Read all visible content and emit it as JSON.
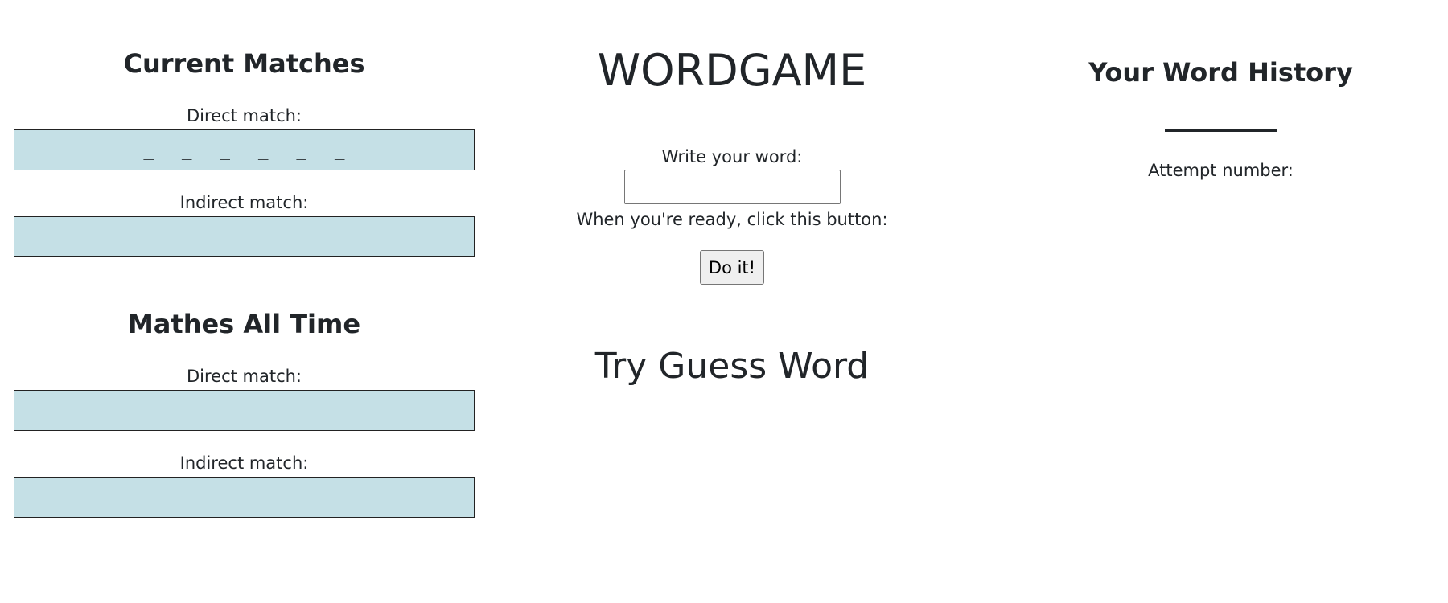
{
  "current_matches": {
    "heading": "Current Matches",
    "direct_label": "Direct match:",
    "direct_slots": [
      "_",
      "_",
      "_",
      "_",
      "_",
      "_"
    ],
    "indirect_label": "Indirect match:",
    "indirect_value": ""
  },
  "all_time": {
    "heading": "Mathes All Time",
    "direct_label": "Direct match:",
    "direct_slots": [
      "_",
      "_",
      "_",
      "_",
      "_",
      "_"
    ],
    "indirect_label": "Indirect match:",
    "indirect_value": ""
  },
  "game": {
    "title": "WORDGAME",
    "input_label": "Write your word:",
    "input_value": "",
    "ready_text": "When you're ready, click this button:",
    "button_label": "Do it!",
    "guess_title": "Try Guess Word"
  },
  "history": {
    "heading": "Your Word History",
    "attempt_label": "Attempt number:"
  },
  "colors": {
    "match_box_bg": "#c5e0e6",
    "text": "#212529"
  }
}
